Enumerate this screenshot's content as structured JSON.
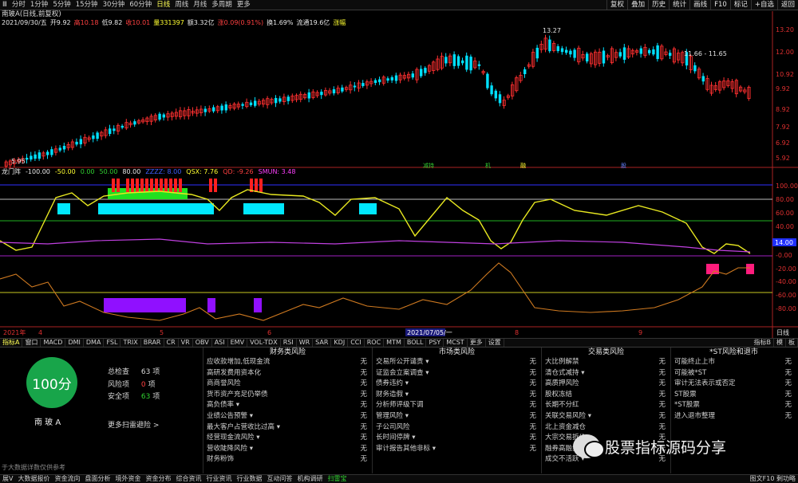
{
  "topbar": {
    "periods": [
      "Ⅲ",
      "分时",
      "1分钟",
      "5分钟",
      "15分钟",
      "30分钟",
      "60分钟",
      "日线",
      "周线",
      "月线",
      "多周期",
      "更多"
    ],
    "active_period": "日线",
    "right_buttons": [
      "复权",
      "叠加",
      "历史",
      "统计",
      "画线",
      "F10",
      "标记",
      "+自选",
      "返回"
    ]
  },
  "title": "南玻A(日线,前复权)",
  "quote": {
    "date": "2021/09/30/五",
    "open": "开9.92",
    "high": "高10.18",
    "low": "低9.82",
    "close": "收10.01",
    "volume": "量331397",
    "amount": "额3.32亿",
    "change": "涨0.09(0.91%)",
    "turnover": "换1.69%",
    "float_cap": "流通19.6亿",
    "extra": "涨幅"
  },
  "price_axis": [
    "13.20",
    "12.00",
    "10.92",
    "9.92",
    "8.92",
    "7.92",
    "6.92",
    "5.92"
  ],
  "price_annotations": {
    "high": "13.27",
    "low": "5.95",
    "range": "11.66 - 11.65"
  },
  "event_markers": [
    "减持",
    "机",
    "融",
    "股"
  ],
  "indicator": {
    "name": "龙门阵",
    "values": [
      "-100.00",
      "-50.00",
      "0.00",
      "50.00",
      "80.00",
      "ZZZZ: 8.00",
      "QSX: 7.76",
      "QD: -9.26",
      "SMUN: 3.48"
    ]
  },
  "indicator_axis": [
    "100.00",
    "80.00",
    "60.00",
    "40.00",
    "20.00",
    "14.00",
    "-0.00",
    "-20.00",
    "-40.00",
    "-60.00",
    "-80.00"
  ],
  "time_axis": {
    "start": "2021年",
    "labels": [
      "4",
      "5",
      "6",
      "2021/07/05/一",
      "8",
      "9"
    ],
    "right": "日线"
  },
  "tabs": [
    "指标A",
    "窗口",
    "MACD",
    "DMI",
    "DMA",
    "FSL",
    "TRIX",
    "BRAR",
    "CR",
    "VR",
    "OBV",
    "ASI",
    "EMV",
    "VOL-TDX",
    "RSI",
    "WR",
    "SAR",
    "KDJ",
    "CCI",
    "ROC",
    "MTM",
    "BOLL",
    "PSY",
    "MCST",
    "更多",
    "设置"
  ],
  "tabs_right": [
    "指标B",
    "模",
    "板"
  ],
  "risk": {
    "score": "100分",
    "stock_name": "南 玻 A",
    "total_label": "总检查",
    "total_value": "63",
    "total_unit": "项",
    "risk_label": "风险项",
    "risk_value": "0",
    "risk_unit": "项",
    "safe_label": "安全项",
    "safe_value": "63",
    "safe_unit": "项",
    "more_link": "更多扫雷避险 >",
    "disclaimer": "于大数据详数仅供参考",
    "columns": [
      {
        "title": "财务类风险",
        "items": [
          "应收款增加,低现金流",
          "高研发费用资本化",
          "商商誉风险",
          "货币资产充足仍举债",
          "高负债率 ▾",
          "业绩公告预警 ▾",
          "最大客户占营收比过高 ▾",
          "经营现金流风险 ▾",
          "营收陡降风险 ▾",
          "财务粉饰"
        ]
      },
      {
        "title": "市场类风险",
        "items": [
          "交易所公开谴责 ▾",
          "证监会立案调查 ▾",
          "债券违约 ▾",
          "财务造假 ▾",
          "分析师评级下调",
          "管理风险 ▾",
          "子公司风险",
          "长时间停牌 ▾",
          "审计报告其他非标 ▾"
        ]
      },
      {
        "title": "交易类风险",
        "items": [
          "大比例解禁",
          "清仓式减持 ▾",
          "高质押风险",
          "股权冻结",
          "长期不分红",
          "关联交易风险 ▾",
          "北上资金减仓",
          "大宗交易折价",
          "融券高融卖",
          "成交不活跃 ▾"
        ]
      },
      {
        "title": "*ST风险和退市",
        "items": [
          "可能终止上市",
          "可能被*ST",
          "审计无法表示或否定",
          "ST股票",
          "*ST股票",
          "进入退市整理"
        ]
      }
    ],
    "none_label": "无"
  },
  "watermark": "股票指标源码分享",
  "bottombar": {
    "items": [
      "展V",
      "大数据报价",
      "资金流向",
      "盘面分析",
      "境外资金",
      "资金分布",
      "综合资讯",
      "行业资讯",
      "行业数据",
      "互动问答",
      "机构调研",
      "扫雷宝"
    ],
    "right": "图文F10 剩功略"
  },
  "colors": {
    "up": "#ff3030",
    "down": "#00e0ff",
    "ma": "#ffff30",
    "panel_bg": "#000000",
    "score_green": "#18a54a"
  }
}
